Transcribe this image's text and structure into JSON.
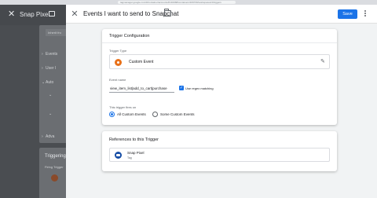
{
  "browser": {
    "url": "tagmanager.google.com/#/container/accounts/6101968/containers/169739/workspaces/4/triggers"
  },
  "background_panel": {
    "close_glyph": "✕",
    "title": "Snap Pixel",
    "inherit_label": "Inherit fro",
    "rows": [
      "Events",
      "User I",
      "Auto",
      "Adva"
    ],
    "triggering_title": "Triggering",
    "firing_triggers": "Firing Trigger"
  },
  "header": {
    "close_glyph": "✕",
    "title": "Events I want to send to Snapchat",
    "save_label": "Save"
  },
  "trigger_config": {
    "title": "Trigger Configuration",
    "type_label": "Trigger Type",
    "type_name": "Custom Event",
    "type_color": "#e8711a",
    "edit_glyph": "✎",
    "event_name_label": "Event name",
    "event_name_value": "view_item_list|add_to_cart|purchase",
    "regex_label": "Use regex matching",
    "regex_checked": true,
    "fires_on_label": "This trigger fires on",
    "option_all": "All Custom Events",
    "option_some": "Some Custom Events",
    "selected_option": "All Custom Events"
  },
  "references": {
    "title": "References to this Trigger",
    "item_name": "Snap Pixel",
    "item_type": "Tag",
    "icon_color": "#174ea6"
  },
  "colors": {
    "accent": "#1a73e8",
    "dim_backdrop": "#5f6368"
  }
}
